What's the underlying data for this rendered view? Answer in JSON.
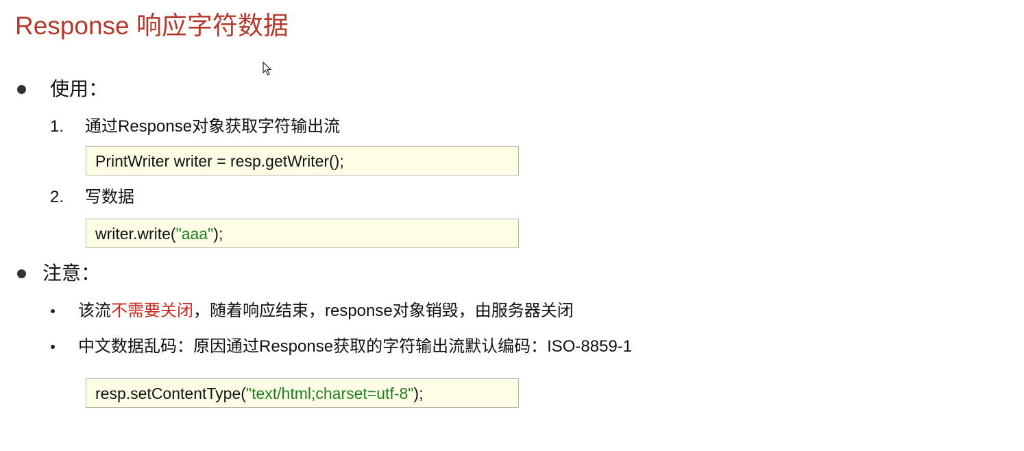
{
  "title": "Response 响应字符数据",
  "usage": {
    "heading": "使用：",
    "steps": [
      {
        "num": "1.",
        "text": "通过Response对象获取字符输出流",
        "code": "PrintWriter writer = resp.getWriter();"
      },
      {
        "num": "2.",
        "text": "写数据",
        "code_prefix": "writer.write(",
        "code_string": "\"aaa\"",
        "code_suffix": ");"
      }
    ]
  },
  "notes": {
    "heading": "注意：",
    "items": [
      {
        "prefix": "该流",
        "highlight": "不需要关闭",
        "suffix": "，随着响应结束，response对象销毁，由服务器关闭"
      },
      {
        "text": "中文数据乱码：原因通过Response获取的字符输出流默认编码：ISO-8859-1"
      }
    ],
    "code_prefix": "resp.setContentType(",
    "code_string": "\"text/html;charset=utf-8\"",
    "code_suffix": ");"
  },
  "colors": {
    "title": "#b5392a",
    "highlight": "#cc2a1e",
    "string": "#1e7d22",
    "code_bg": "#fefde6"
  }
}
